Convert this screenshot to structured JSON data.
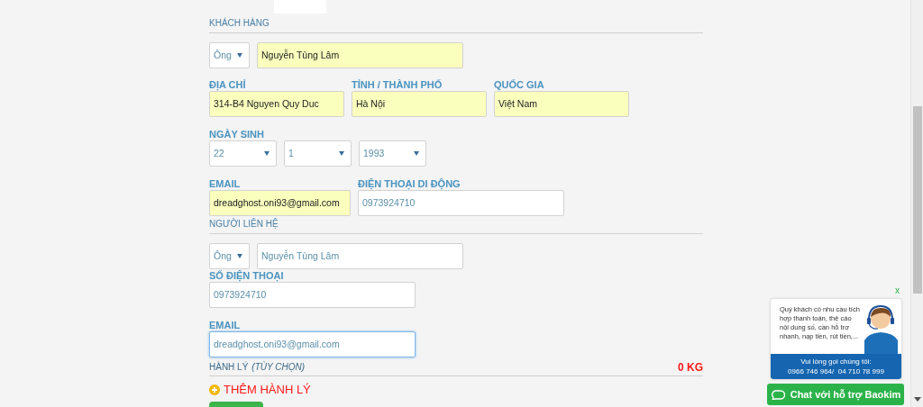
{
  "customer": {
    "heading": "KHÁCH HÀNG",
    "salutation": {
      "value": "Ông",
      "autofilled": false
    },
    "full_name": {
      "value": "Nguyễn Tùng Lâm",
      "autofilled": true
    },
    "address": {
      "label": "ĐỊA CHỈ",
      "value": "314-B4 Nguyen Quy Duc",
      "autofilled": true
    },
    "city": {
      "label": "TỈNH / THÀNH PHỐ",
      "value": "Hà Nội",
      "autofilled": true
    },
    "country": {
      "label": "QUỐC GIA",
      "value": "Việt Nam",
      "autofilled": true
    },
    "birth_date": {
      "label": "NGÀY SINH",
      "day": {
        "value": "22",
        "autofilled": false
      },
      "month": {
        "value": "1",
        "autofilled": false
      },
      "year": {
        "value": "1993",
        "autofilled": false
      }
    },
    "email": {
      "label": "EMAIL",
      "value": "dreadghost.oni93@gmail.com",
      "autofilled": true
    },
    "mobile": {
      "label": "ĐIỆN THOẠI DI ĐỘNG",
      "value": "0973924710",
      "autofilled": false
    }
  },
  "contact": {
    "heading": "NGƯỜI LIÊN HỆ",
    "salutation": {
      "value": "Ông",
      "autofilled": false
    },
    "full_name": {
      "value": "Nguyễn Tùng Lâm",
      "autofilled": false
    },
    "phone": {
      "label": "SỐ ĐIỆN THOẠI",
      "value": "0973924710",
      "autofilled": false
    },
    "email": {
      "label": "EMAIL",
      "value": "dreadghost.oni93@gmail.com",
      "autofilled": false,
      "focused": true
    }
  },
  "baggage": {
    "heading": "HÀNH LÝ",
    "heading_note": "(TÙY CHỌN)",
    "weight": "0 KG",
    "add_button": "THÊM HÀNH LÝ"
  },
  "chat_widget": {
    "close": "x",
    "message": "Quý khách có nhu cầu tích hợp thanh toán, thẻ cào nội dung số, cần hỗ trợ nhanh, nạp tiền, rút tiền,...",
    "call_prompt": "Vui lòng gọi chúng tôi:",
    "phones": "0966 746 964/  04 710 78 999",
    "chat_button": "Chat với hỗ trợ Baokim"
  }
}
